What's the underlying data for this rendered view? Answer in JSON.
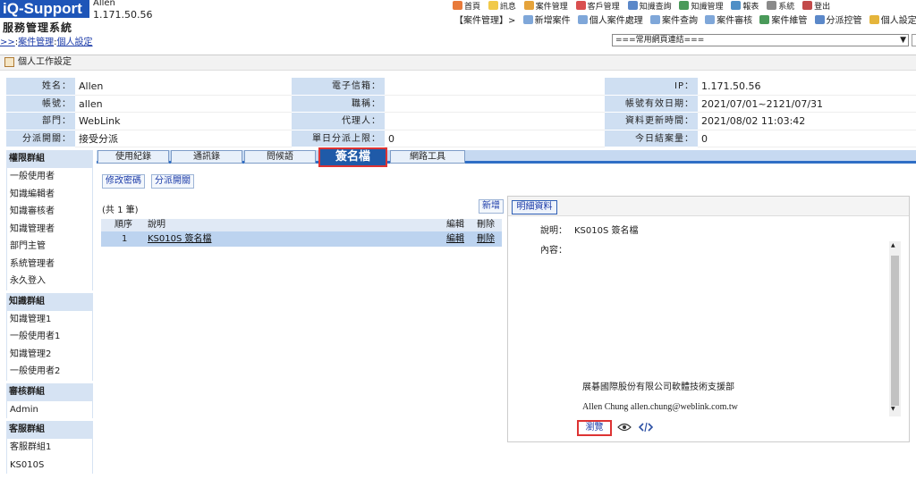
{
  "header": {
    "logo": "iQ-Support",
    "user_name": "Allen",
    "user_ip": "1.171.50.56",
    "system_title": "服務管理系統",
    "breadcrumb": {
      "prefix": ">>",
      "sep": ":",
      "item1": "案件管理",
      "item2": "個人設定"
    },
    "top_menu": [
      "首頁",
      "訊息",
      "案件管理",
      "客戶管理",
      "知識查詢",
      "知識管理",
      "報表",
      "系統",
      "登出"
    ],
    "sub_menu": {
      "section": "【案件管理】>",
      "items": [
        "新增案件",
        "個人案件處理",
        "案件查詢",
        "案件審核",
        "案件維管",
        "分派控管",
        "個人設定"
      ]
    },
    "quick_links": "===常用網頁連結==="
  },
  "page_title": "個人工作設定",
  "info": {
    "rows": [
      [
        {
          "label": "姓名：",
          "value": "Allen"
        },
        {
          "label": "電子信箱：",
          "value": ""
        },
        {
          "label": "IP：",
          "value": "1.171.50.56"
        }
      ],
      [
        {
          "label": "帳號：",
          "value": "allen"
        },
        {
          "label": "職稱：",
          "value": ""
        },
        {
          "label": "帳號有效日期：",
          "value": "2021/07/01~2121/07/31"
        }
      ],
      [
        {
          "label": "部門：",
          "value": "WebLink"
        },
        {
          "label": "代理人：",
          "value": ""
        },
        {
          "label": "資料更新時間：",
          "value": "2021/08/02 11:03:42"
        }
      ],
      [
        {
          "label": "分派開關：",
          "value": "接受分派"
        },
        {
          "label": "單日分派上限：",
          "value": "0"
        },
        {
          "label": "今日結案量：",
          "value": "0"
        }
      ]
    ]
  },
  "tabs": [
    "使用紀錄",
    "通訊錄",
    "問候語",
    "簽名檔",
    "網路工具"
  ],
  "active_tab": "簽名檔",
  "sidebar": {
    "groups": [
      {
        "title": "權限群組",
        "items": [
          "一般使用者",
          "知識編輯者",
          "知識審核者",
          "知識管理者",
          "部門主管",
          "系統管理者",
          "永久登入"
        ]
      },
      {
        "title": "知識群組",
        "items": [
          "知識管理1",
          "一般使用者1",
          "知識管理2",
          "一般使用者2"
        ]
      },
      {
        "title": "審核群組",
        "items": [
          "Admin"
        ]
      },
      {
        "title": "客服群組",
        "items": [
          "客服群組1",
          "KS010S"
        ]
      }
    ]
  },
  "actions": {
    "change_password": "修改密碼",
    "dispatch_switch": "分派開關"
  },
  "list": {
    "count_text": "(共 1 筆)",
    "add_label": "新增",
    "columns": {
      "seq": "順序",
      "desc": "說明",
      "edit": "編輯",
      "delete": "刪除"
    },
    "rows": [
      {
        "seq": "1",
        "desc": "KS010S 簽名檔",
        "edit": "編輯",
        "delete": "刪除"
      }
    ]
  },
  "detail": {
    "tab": "明細資料",
    "desc_label": "說明：",
    "desc_value": "KS010S 簽名檔",
    "content_label": "內容：",
    "signature_company": "展碁國際股份有限公司軟體技術支援部",
    "signature_email": "Allen Chung allen.chung@weblink.com.tw",
    "browse_label": "瀏覽"
  },
  "colors": {
    "brand": "#1e55b8",
    "label_bg": "#cfdff2",
    "tab_active": "#1f5aa8",
    "highlight": "#dd3333"
  }
}
